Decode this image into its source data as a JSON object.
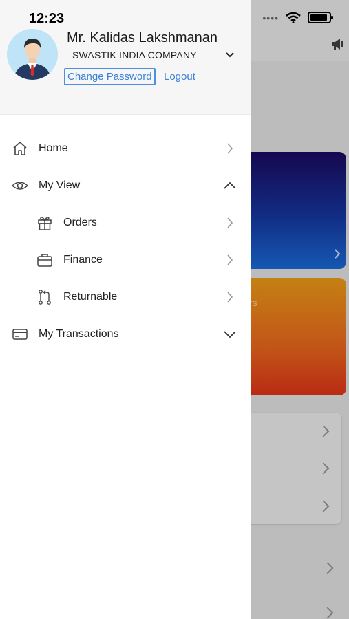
{
  "status_bar": {
    "time": "12:23"
  },
  "profile": {
    "name": "Mr. Kalidas Lakshmanan",
    "company": "SWASTIK INDIA COMPANY",
    "change_password": "Change Password",
    "logout": "Logout"
  },
  "menu": {
    "home": "Home",
    "my_view": "My View",
    "orders": "Orders",
    "finance": "Finance",
    "returnable": "Returnable",
    "my_transactions": "My Transactions"
  },
  "background": {
    "card_partial_text": "rs"
  },
  "colors": {
    "link": "#3b82d8",
    "card_blue_top": "#1c0a63",
    "card_blue_bottom": "#1b6fe0",
    "card_orange_top": "#f6a11a",
    "card_orange_bottom": "#e8361a"
  }
}
